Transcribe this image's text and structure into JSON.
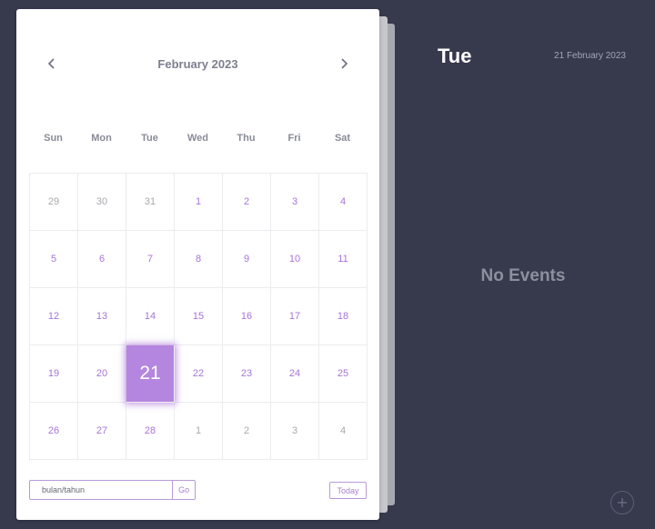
{
  "calendar": {
    "month_title": "February 2023",
    "prev_icon": "chevron-left-icon",
    "next_icon": "chevron-right-icon",
    "weekdays": [
      "Sun",
      "Mon",
      "Tue",
      "Wed",
      "Thu",
      "Fri",
      "Sat"
    ],
    "weeks": [
      [
        {
          "d": "29",
          "m": true
        },
        {
          "d": "30",
          "m": true
        },
        {
          "d": "31",
          "m": true
        },
        {
          "d": "1"
        },
        {
          "d": "2"
        },
        {
          "d": "3"
        },
        {
          "d": "4"
        }
      ],
      [
        {
          "d": "5"
        },
        {
          "d": "6"
        },
        {
          "d": "7"
        },
        {
          "d": "8"
        },
        {
          "d": "9"
        },
        {
          "d": "10"
        },
        {
          "d": "11"
        }
      ],
      [
        {
          "d": "12"
        },
        {
          "d": "13"
        },
        {
          "d": "14"
        },
        {
          "d": "15"
        },
        {
          "d": "16"
        },
        {
          "d": "17"
        },
        {
          "d": "18"
        }
      ],
      [
        {
          "d": "19"
        },
        {
          "d": "20"
        },
        {
          "d": "21",
          "sel": true
        },
        {
          "d": "22"
        },
        {
          "d": "23"
        },
        {
          "d": "24"
        },
        {
          "d": "25"
        }
      ],
      [
        {
          "d": "26"
        },
        {
          "d": "27"
        },
        {
          "d": "28"
        },
        {
          "d": "1",
          "m": true
        },
        {
          "d": "2",
          "m": true
        },
        {
          "d": "3",
          "m": true
        },
        {
          "d": "4",
          "m": true
        }
      ]
    ],
    "month_input_placeholder": "bulan/tahun",
    "go_label": "Go",
    "today_label": "Today"
  },
  "sidebar": {
    "day_name": "Tue",
    "full_date": "21 February 2023",
    "empty_text": "No Events",
    "add_icon": "plus-icon"
  },
  "colors": {
    "background": "#373a4d",
    "accent": "#b586df",
    "day_text": "#a775d6",
    "muted_text": "#a8a8ae"
  }
}
